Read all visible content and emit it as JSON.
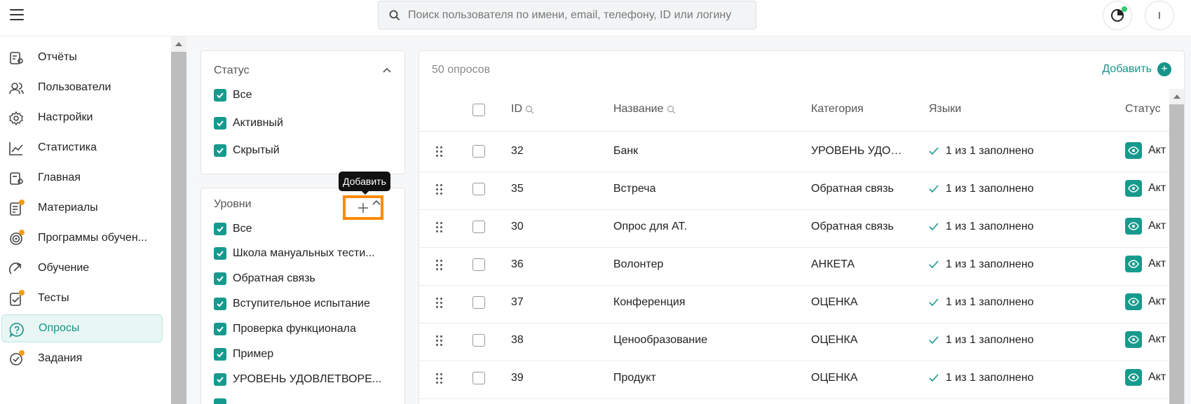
{
  "header": {
    "search_placeholder": "Поиск пользователя по имени, email, телефону, ID или логину",
    "user_initial": "I"
  },
  "sidebar": {
    "items": [
      {
        "label": "Отчёты",
        "icon": "report-icon",
        "badge": false,
        "active": false
      },
      {
        "label": "Пользователи",
        "icon": "users-icon",
        "badge": false,
        "active": false
      },
      {
        "label": "Настройки",
        "icon": "gear-icon",
        "badge": false,
        "active": false
      },
      {
        "label": "Статистика",
        "icon": "chart-line-icon",
        "badge": false,
        "active": false
      },
      {
        "label": "Главная",
        "icon": "home-doc-icon",
        "badge": false,
        "active": false
      },
      {
        "label": "Материалы",
        "icon": "materials-icon",
        "badge": true,
        "active": false
      },
      {
        "label": "Программы обучен...",
        "icon": "target-icon",
        "badge": true,
        "active": false
      },
      {
        "label": "Обучение",
        "icon": "learning-arrow-icon",
        "badge": false,
        "active": false
      },
      {
        "label": "Тесты",
        "icon": "tests-icon",
        "badge": true,
        "active": false
      },
      {
        "label": "Опросы",
        "icon": "survey-icon",
        "badge": false,
        "active": true
      },
      {
        "label": "Задания",
        "icon": "tasks-icon",
        "badge": true,
        "active": false
      }
    ]
  },
  "filters": {
    "status": {
      "title": "Статус",
      "options": [
        "Все",
        "Активный",
        "Скрытый"
      ]
    },
    "levels": {
      "title": "Уровни",
      "tooltip": "Добавить",
      "options": [
        "Все",
        "Школа мануальных тести...",
        "Обратная связь",
        "Вступительное испытание",
        "Проверка функционала",
        "Пример",
        "УРОВЕНЬ УДОВЛЕТВОРЕ..."
      ]
    }
  },
  "table": {
    "count": "50 опросов",
    "add_label": "Добавить",
    "columns": {
      "id": "ID",
      "name": "Название",
      "category": "Категория",
      "languages": "Языки",
      "status": "Статус"
    },
    "rows": [
      {
        "id": "32",
        "name": "Банк",
        "category": "УРОВЕНЬ УДОВ...",
        "languages": "1 из 1 заполнено",
        "status": "Акт"
      },
      {
        "id": "35",
        "name": "Встреча",
        "category": "Обратная связь",
        "languages": "1 из 1 заполнено",
        "status": "Акт"
      },
      {
        "id": "30",
        "name": "Опрос для АТ.",
        "category": "Обратная связь",
        "languages": "1 из 1 заполнено",
        "status": "Акт"
      },
      {
        "id": "36",
        "name": "Волонтер",
        "category": "АНКЕТА",
        "languages": "1 из 1 заполнено",
        "status": "Акт"
      },
      {
        "id": "37",
        "name": "Конференция",
        "category": "ОЦЕНКА",
        "languages": "1 из 1 заполнено",
        "status": "Акт"
      },
      {
        "id": "38",
        "name": "Ценообразование",
        "category": "ОЦЕНКА",
        "languages": "1 из 1 заполнено",
        "status": "Акт"
      },
      {
        "id": "39",
        "name": "Продукт",
        "category": "ОЦЕНКА",
        "languages": "1 из 1 заполнено",
        "status": "Акт"
      }
    ]
  },
  "colors": {
    "accent": "#179a8d",
    "badge": "#f39c12",
    "highlight": "#ff8a00"
  }
}
